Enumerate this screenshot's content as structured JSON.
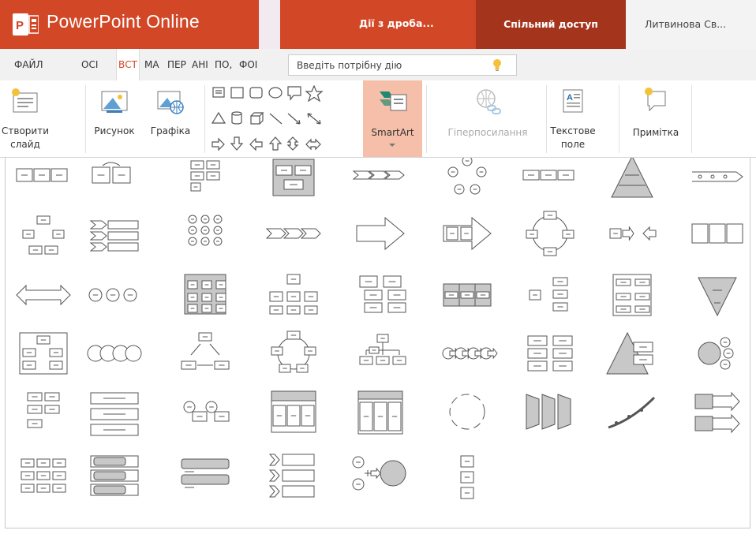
{
  "titlebar": {
    "app_name": "PowerPoint Online",
    "document_name": "Дії з дроба...",
    "share_label": "Спільний доступ",
    "user_name": "Литвинова Св..."
  },
  "tabs": [
    {
      "label": "ФАЙЛ",
      "active": false
    },
    {
      "label": "ОСІ",
      "active": false
    },
    {
      "label": "ВСТ",
      "active": true
    },
    {
      "label": "МА",
      "active": false
    },
    {
      "label": "ПЕР",
      "active": false
    },
    {
      "label": "АНІ",
      "active": false
    },
    {
      "label": "ПО,",
      "active": false
    },
    {
      "label": "ФОІ",
      "active": false
    }
  ],
  "tell_me": {
    "placeholder": "Введіть потрібну дію"
  },
  "ribbon": {
    "new_slide": "Створити слайд",
    "picture": "Рисунок",
    "graphics": "Графіка",
    "smartart": "SmartArt",
    "hyperlink": "Гіперпосилання",
    "textbox": "Текстове поле",
    "comment": "Примітка"
  },
  "gallery": {
    "name": "SmartArt layouts",
    "rows": [
      [
        "horizontal-bullet-list",
        "stacked-list",
        "alternating-flow",
        "grouped-list",
        "basic-chevron-process",
        "basic-cycle",
        "continuous-block-process",
        "basic-pyramid",
        "timeline"
      ],
      [
        "cycle-with-boxes",
        "vertical-chevron-list",
        "bending-process",
        "chevron-process",
        "block-arrow",
        "process-arrows",
        "circular-arrow-cycle",
        "opposing-arrows",
        "equation-blocks"
      ],
      [
        "double-arrow",
        "circle-equation",
        "table-list",
        "organization-chart",
        "hierarchy-list",
        "vertical-box-list",
        "horizontal-hierarchy",
        "lined-list",
        "inverted-pyramid"
      ],
      [
        "hierarchy-boxes",
        "interlocking-circles",
        "radial-arrows",
        "segmented-cycle",
        "tree-hierarchy",
        "circular-arrow-process",
        "block-grid",
        "pyramid-list",
        "target-circles"
      ],
      [
        "multilevel-process",
        "stacked-arrow-list",
        "labeled-circles",
        "three-column-table",
        "four-panel-table",
        "dashed-cycle",
        "trapezoid-panels",
        "ascending-arrow",
        "double-arrow-list"
      ],
      [
        "grid-matrix",
        "bracket-list",
        "titled-lines",
        "chevron-bullets",
        "plus-equation",
        "downward-process"
      ]
    ]
  },
  "colors": {
    "brand": "#d24726",
    "share": "#a5341c",
    "smartart_highlight": "#f5bfa9"
  }
}
